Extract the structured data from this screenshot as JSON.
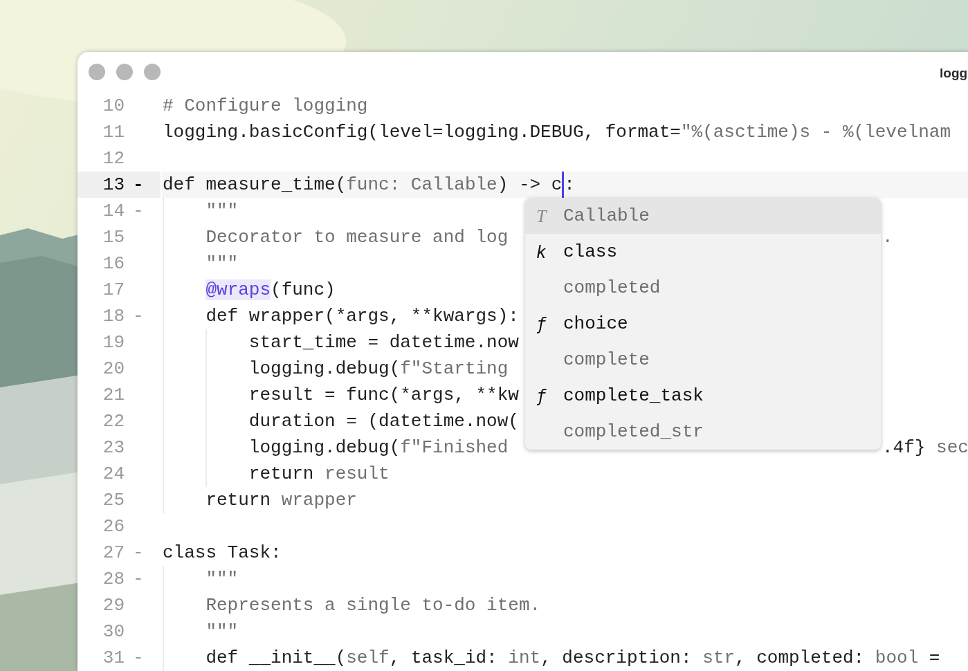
{
  "window": {
    "title": "logg"
  },
  "editor": {
    "lines": [
      {
        "number": "10",
        "current": false,
        "segments": [
          {
            "text": "# Configure logging",
            "dimmed": true
          }
        ]
      },
      {
        "number": "11",
        "current": false,
        "segments": [
          {
            "text": "logging.basicConfig(level=logging.DEBUG, format=",
            "dimmed": false
          },
          {
            "text": "\"%(asctime)s - %(levelnam",
            "dimmed": true
          }
        ]
      },
      {
        "number": "12",
        "current": false
      },
      {
        "number": "13",
        "current": true,
        "fold_mark": "-",
        "segments": [
          {
            "text": "def measure_time(",
            "dimmed": false
          },
          {
            "text": "func: Callable",
            "dimmed": true
          },
          {
            "text": ") -> c",
            "dimmed": false
          },
          {
            "text": ":",
            "dimmed": false,
            "cursor_before": true
          }
        ]
      },
      {
        "number": "14",
        "current": false,
        "fold_mark": "-",
        "segments": [
          {
            "text": "    \"\"\"",
            "dimmed": true
          }
        ]
      },
      {
        "number": "15",
        "current": false,
        "segments": [
          {
            "text": "    Decorator to measure and log",
            "dimmed": true
          }
        ],
        "tail": [
          {
            "text": ".",
            "dimmed": true
          }
        ]
      },
      {
        "number": "16",
        "current": false,
        "segments": [
          {
            "text": "    \"\"\"",
            "dimmed": true
          }
        ]
      },
      {
        "number": "17",
        "current": false,
        "segments": [
          {
            "text": "    @wraps",
            "dimmed": false,
            "highlighted": true
          },
          {
            "text": "(func)",
            "dimmed": false
          }
        ]
      },
      {
        "number": "18",
        "current": false,
        "fold_mark": "-",
        "segments": [
          {
            "text": "    def wrapper(*args, **kwargs):",
            "dimmed": false
          }
        ]
      },
      {
        "number": "19",
        "current": false,
        "segments": [
          {
            "text": "        start_time = datetime.now",
            "dimmed": false
          }
        ]
      },
      {
        "number": "20",
        "current": false,
        "segments": [
          {
            "text": "        logging.debug(",
            "dimmed": false
          },
          {
            "text": "f\"Starting",
            "dimmed": true
          }
        ]
      },
      {
        "number": "21",
        "current": false,
        "segments": [
          {
            "text": "        result = func(*args, **kw",
            "dimmed": false
          }
        ]
      },
      {
        "number": "22",
        "current": false,
        "segments": [
          {
            "text": "        duration = (datetime.now(",
            "dimmed": false
          }
        ]
      },
      {
        "number": "23",
        "current": false,
        "segments": [
          {
            "text": "        logging.debug(",
            "dimmed": false
          },
          {
            "text": "f\"Finished",
            "dimmed": true
          }
        ],
        "tail": [
          {
            "text": ".4f}",
            "dimmed": false
          },
          {
            "text": " sec",
            "dimmed": true
          }
        ]
      },
      {
        "number": "24",
        "current": false,
        "segments": [
          {
            "text": "        return ",
            "dimmed": false
          },
          {
            "text": "result",
            "dimmed": true
          }
        ]
      },
      {
        "number": "25",
        "current": false,
        "segments": [
          {
            "text": "    return ",
            "dimmed": false
          },
          {
            "text": "wrapper",
            "dimmed": true
          }
        ]
      },
      {
        "number": "26",
        "current": false
      },
      {
        "number": "27",
        "current": false,
        "fold_mark": "-",
        "segments": [
          {
            "text": "class Task:",
            "dimmed": false
          }
        ]
      },
      {
        "number": "28",
        "current": false,
        "fold_mark": "-",
        "segments": [
          {
            "text": "    \"\"\"",
            "dimmed": true
          }
        ]
      },
      {
        "number": "29",
        "current": false,
        "segments": [
          {
            "text": "    Represents a single to-do item.",
            "dimmed": true
          }
        ]
      },
      {
        "number": "30",
        "current": false,
        "segments": [
          {
            "text": "    \"\"\"",
            "dimmed": true
          }
        ]
      },
      {
        "number": "31",
        "current": false,
        "fold_mark": "-",
        "segments": [
          {
            "text": "    def __init__(",
            "dimmed": false
          },
          {
            "text": "self",
            "dimmed": true
          },
          {
            "text": ", task_id: ",
            "dimmed": false
          },
          {
            "text": "int",
            "dimmed": true
          },
          {
            "text": ", description: ",
            "dimmed": false
          },
          {
            "text": "str",
            "dimmed": true
          },
          {
            "text": ", completed: ",
            "dimmed": false
          },
          {
            "text": "bool",
            "dimmed": true
          },
          {
            "text": " =",
            "dimmed": false
          }
        ]
      }
    ]
  },
  "completion": {
    "items": [
      {
        "icon": "T",
        "label": "Callable",
        "selected": true,
        "dimmed": true
      },
      {
        "icon": "k",
        "label": "class",
        "selected": false,
        "dimmed": false
      },
      {
        "label": "completed",
        "selected": false,
        "dimmed": true
      },
      {
        "icon": "ƒ",
        "label": "choice",
        "selected": false,
        "dimmed": false
      },
      {
        "label": "complete",
        "selected": false,
        "dimmed": true
      },
      {
        "icon": "ƒ",
        "label": "complete_task",
        "selected": false,
        "dimmed": false
      },
      {
        "label": "completed_str",
        "selected": false,
        "dimmed": true
      }
    ]
  }
}
